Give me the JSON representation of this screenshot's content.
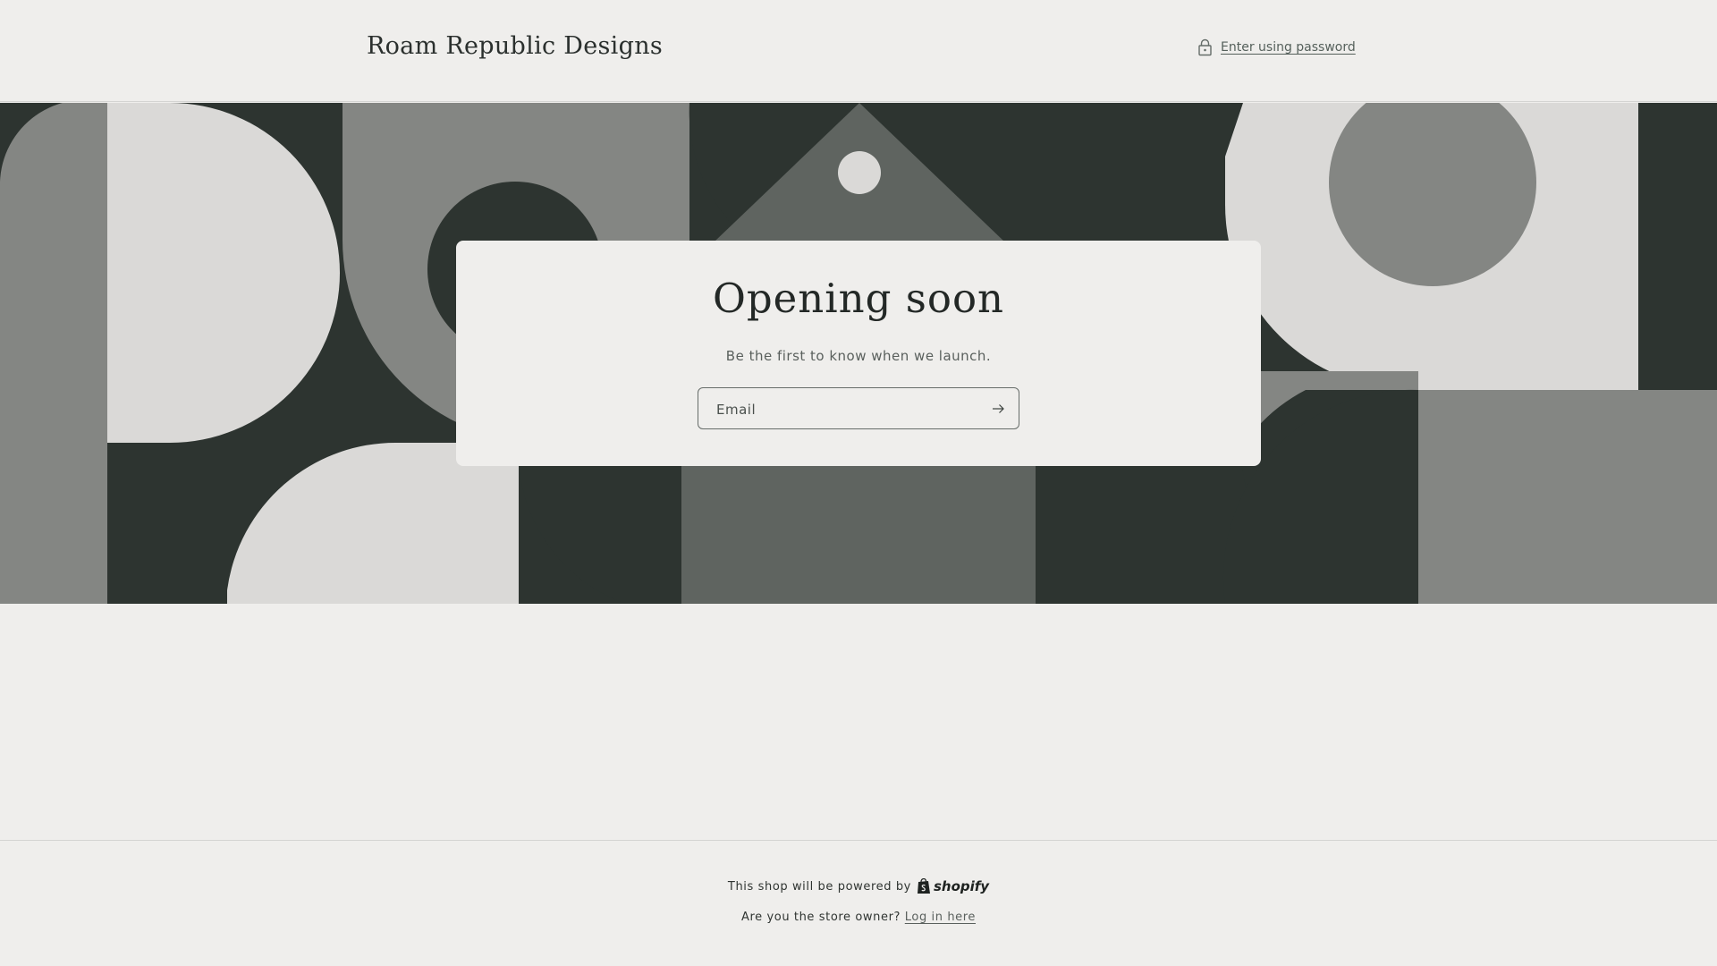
{
  "header": {
    "store_name": "Roam Republic Designs",
    "password_link": "Enter using password",
    "lock_icon": "lock-icon"
  },
  "banner": {
    "palette": {
      "dark": "#2d3430",
      "mid": "#5f6460",
      "gray": "#848683",
      "light": "#dad9d7"
    }
  },
  "card": {
    "title": "Opening soon",
    "subtitle": "Be the first to know when we launch.",
    "email_placeholder": "Email",
    "submit_icon": "arrow-right-icon"
  },
  "footer": {
    "powered_text": "This shop will be powered by",
    "shopify_label": "shopify",
    "owner_text": "Are you the store owner?",
    "login_link": "Log in here"
  },
  "colors": {
    "background": "#efeeec",
    "text": "#232826",
    "border": "#d4d4d2"
  }
}
